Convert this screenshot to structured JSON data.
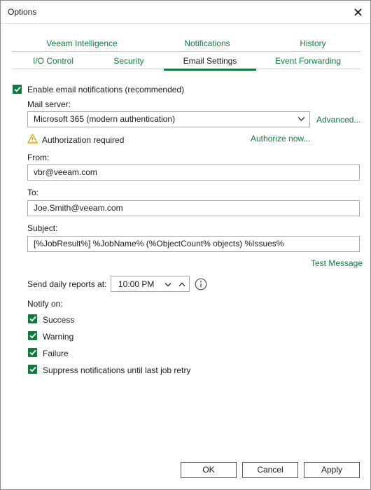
{
  "window": {
    "title": "Options"
  },
  "tabs_top": [
    {
      "label": "Veeam Intelligence"
    },
    {
      "label": "Notifications"
    },
    {
      "label": "History"
    }
  ],
  "tabs_bottom": [
    {
      "label": "I/O Control"
    },
    {
      "label": "Security"
    },
    {
      "label": "Email Settings",
      "active": true
    },
    {
      "label": "Event Forwarding"
    }
  ],
  "email": {
    "enable_label": "Enable email notifications (recommended)",
    "enable_checked": true,
    "mail_server_label": "Mail server:",
    "mail_server_value": "Microsoft 365 (modern authentication)",
    "advanced_link": "Advanced...",
    "auth_warning": "Authorization required",
    "authorize_link": "Authorize now...",
    "from_label": "From:",
    "from_value": "vbr@veeam.com",
    "to_label": "To:",
    "to_value": "Joe.Smith@veeam.com",
    "subject_label": "Subject:",
    "subject_value": "[%JobResult%] %JobName% (%ObjectCount% objects) %Issues%",
    "test_link": "Test Message",
    "daily_label": "Send daily reports at:",
    "daily_time": "10:00 PM",
    "notify_label": "Notify on:",
    "notify_options": [
      {
        "label": "Success",
        "checked": true
      },
      {
        "label": "Warning",
        "checked": true
      },
      {
        "label": "Failure",
        "checked": true
      },
      {
        "label": "Suppress notifications until last job retry",
        "checked": true
      }
    ]
  },
  "buttons": {
    "ok": "OK",
    "cancel": "Cancel",
    "apply": "Apply"
  },
  "colors": {
    "accent": "#0d7d3e",
    "warning": "#f0a30a"
  }
}
